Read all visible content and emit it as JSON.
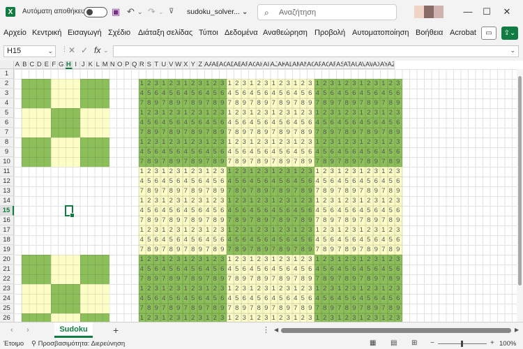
{
  "titlebar": {
    "logo": "X",
    "autosave_label": "Αυτόματη αποθήκευση",
    "filename": "sudoku_solver... ⌄",
    "search_placeholder": "Αναζήτηση",
    "icons": [
      "save-icon",
      "undo-icon",
      "redo-icon",
      "customize-icon"
    ]
  },
  "menu": {
    "items": [
      "Αρχείο",
      "Κεντρική",
      "Εισαγωγή",
      "Σχέδιο",
      "Διάταξη σελίδας",
      "Τύποι",
      "Δεδομένα",
      "Αναθεώρηση",
      "Προβολή",
      "Αυτοματοποίηση",
      "Βοήθεια",
      "Acrobat"
    ]
  },
  "formula": {
    "namebox": "H15",
    "value": ""
  },
  "grid": {
    "columns": [
      "A",
      "B",
      "C",
      "D",
      "E",
      "F",
      "G",
      "H",
      "I",
      "J",
      "K",
      "L",
      "M",
      "N",
      "O",
      "P",
      "Q",
      "R",
      "S",
      "T",
      "U",
      "V",
      "W",
      "X",
      "Y",
      "Z",
      "AA",
      "AB",
      "AC",
      "AD",
      "AE",
      "AF",
      "AG",
      "AH",
      "AI",
      "AJ",
      "AK",
      "AL",
      "AM",
      "AN",
      "AO",
      "AP",
      "AQ",
      "AR",
      "AS",
      "AT",
      "AU",
      "AV",
      "AW",
      "AX",
      "AY",
      "AZ"
    ],
    "rows": [
      "1",
      "2",
      "3",
      "4",
      "5",
      "6",
      "7",
      "8",
      "9",
      "10",
      "11",
      "12",
      "13",
      "14",
      "15",
      "16",
      "17",
      "18",
      "19",
      "20",
      "21",
      "22",
      "23",
      "24",
      "25",
      "26"
    ],
    "selected_column": "H",
    "selected_row": "15",
    "digit_rows": [
      [
        "1",
        "2",
        "3"
      ],
      [
        "4",
        "5",
        "6"
      ],
      [
        "7",
        "8",
        "9"
      ]
    ]
  },
  "colors": {
    "green": "#8cbf5a",
    "yellow": "#fdfdc8",
    "accent": "#107c41"
  },
  "sheet": {
    "tab_label": "Sudoku",
    "add_label": "+"
  },
  "status": {
    "ready": "Έτοιμο",
    "accessibility": "Προσβασιμότητα: Διερεύνηση",
    "zoom": "100%"
  }
}
